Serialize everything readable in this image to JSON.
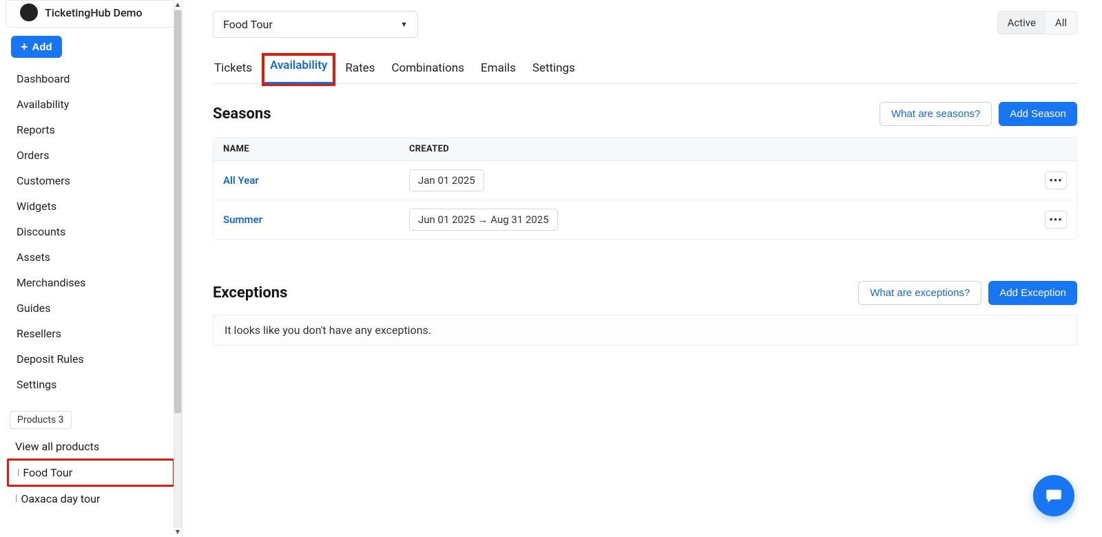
{
  "brand": {
    "name": "TicketingHub Demo"
  },
  "addButton": {
    "label": "Add"
  },
  "nav": {
    "items": [
      "Dashboard",
      "Availability",
      "Reports",
      "Orders",
      "Customers",
      "Widgets",
      "Discounts",
      "Assets",
      "Merchandises",
      "Guides",
      "Resellers",
      "Deposit Rules",
      "Settings"
    ]
  },
  "products": {
    "badge": "Products 3",
    "viewAll": "View all products",
    "items": [
      "Food Tour",
      "Oaxaca day tour"
    ]
  },
  "dropdown": {
    "selected": "Food Tour"
  },
  "statusToggle": {
    "active": "Active",
    "all": "All"
  },
  "tabs": [
    "Tickets",
    "Availability",
    "Rates",
    "Combinations",
    "Emails",
    "Settings"
  ],
  "seasons": {
    "title": "Seasons",
    "helpLabel": "What are seasons?",
    "addLabel": "Add Season",
    "columns": {
      "name": "NAME",
      "created": "CREATED"
    },
    "rows": [
      {
        "name": "All Year",
        "created": "Jan 01 2025"
      },
      {
        "name": "Summer",
        "created": "Jun 01 2025 → Aug 31 2025"
      }
    ]
  },
  "exceptions": {
    "title": "Exceptions",
    "helpLabel": "What are exceptions?",
    "addLabel": "Add Exception",
    "empty": "It looks like you don't have any exceptions."
  }
}
